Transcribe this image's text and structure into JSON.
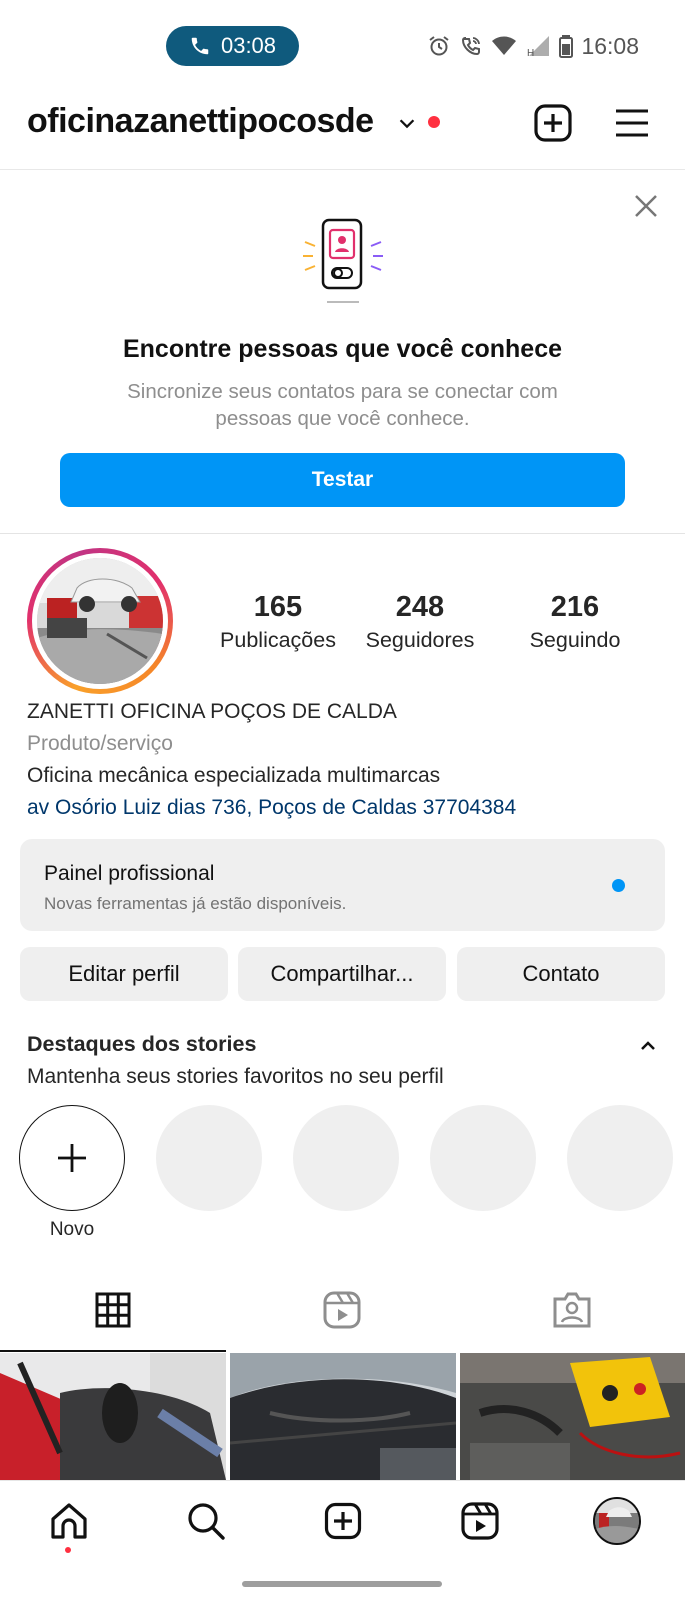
{
  "status_bar": {
    "call_time": "03:08",
    "clock": "16:08"
  },
  "header": {
    "username": "oficinazanettipocosde"
  },
  "find_people": {
    "title": "Encontre pessoas que você conhece",
    "subtitle": "Sincronize seus contatos para se conectar com pessoas que você conhece.",
    "button_label": "Testar"
  },
  "profile": {
    "stats": [
      {
        "value": "165",
        "label": "Publicações"
      },
      {
        "value": "248",
        "label": "Seguidores"
      },
      {
        "value": "216",
        "label": "Seguindo"
      }
    ],
    "name": "ZANETTI OFICINA POÇOS DE CALDA",
    "category": "Produto/serviço",
    "bio": "Oficina mecânica especializada multimarcas",
    "address": "av Osório Luiz dias 736, Poços de Caldas 37704384"
  },
  "pro_panel": {
    "title": "Painel profissional",
    "subtitle": "Novas ferramentas já estão disponíveis."
  },
  "actions": {
    "edit": "Editar perfil",
    "share": "Compartilhar...",
    "contact": "Contato"
  },
  "highlights": {
    "title": "Destaques dos stories",
    "subtitle": "Mantenha seus stories favoritos no seu perfil",
    "new_label": "Novo"
  },
  "tabs": [
    "grid-icon",
    "reels-icon",
    "tagged-icon"
  ],
  "bottom_nav": [
    "home-icon",
    "search-icon",
    "create-icon",
    "reels-icon",
    "profile-avatar"
  ],
  "colors": {
    "accent_blue": "#0095f6",
    "notification_red": "#ff3040",
    "call_pill": "#0f5a7d",
    "link": "#00376b"
  }
}
